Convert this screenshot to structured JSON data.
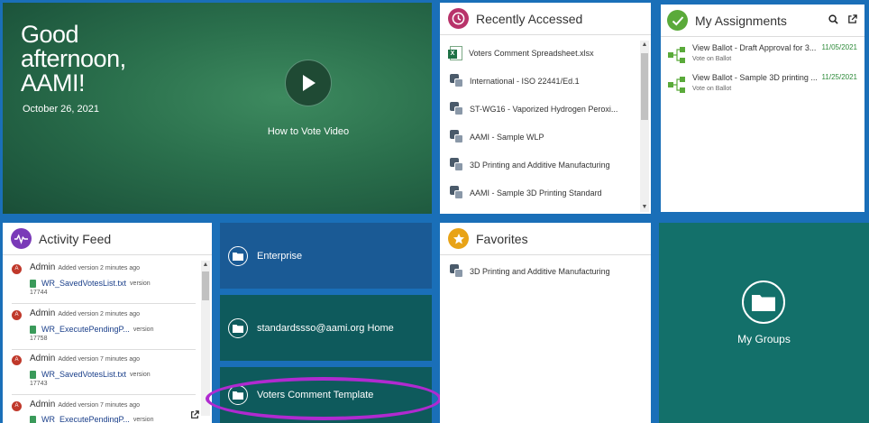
{
  "hero": {
    "greeting_line1": "Good",
    "greeting_line2": "afternoon,",
    "greeting_line3": "AAMI!",
    "date": "October 26, 2021",
    "video_label": "How to Vote Video",
    "play_icon": "play-icon"
  },
  "recent": {
    "title": "Recently Accessed",
    "icon": "clock-icon",
    "accent": "#b8336a",
    "items": [
      {
        "label": "Voters Comment Spreadsheet.xlsx",
        "icon": "excel-icon"
      },
      {
        "label": "International - ISO 22441/Ed.1",
        "icon": "document-icon"
      },
      {
        "label": "ST-WG16 - Vaporized Hydrogen Peroxi...",
        "icon": "document-icon"
      },
      {
        "label": "AAMI - Sample WLP",
        "icon": "document-icon"
      },
      {
        "label": "3D Printing and Additive Manufacturing",
        "icon": "document-icon"
      },
      {
        "label": "AAMI - Sample 3D Printing Standard",
        "icon": "document-icon"
      }
    ]
  },
  "assignments": {
    "title": "My Assignments",
    "accent": "#5aaa3a",
    "items": [
      {
        "title": "View Ballot - Draft Approval for 3...",
        "subtitle": "Vote on Ballot",
        "date": "11/05/2021"
      },
      {
        "title": "View Ballot - Sample 3D printing ...",
        "subtitle": "Vote on Ballot",
        "date": "11/25/2021"
      }
    ]
  },
  "activity": {
    "title": "Activity Feed",
    "accent": "#7a3ab8",
    "items": [
      {
        "avatar": "A",
        "user": "Admin",
        "action": "Added version 2 minutes ago",
        "file": "WR_SavedVotesList.txt",
        "suffix": "version",
        "number": "17744"
      },
      {
        "avatar": "A",
        "user": "Admin",
        "action": "Added version 2 minutes ago",
        "file": "WR_ExecutePendingP...",
        "suffix": "version",
        "number": "17758"
      },
      {
        "avatar": "A",
        "user": "Admin",
        "action": "Added version 7 minutes ago",
        "file": "WR_SavedVotesList.txt",
        "suffix": "version",
        "number": "17743"
      },
      {
        "avatar": "A",
        "user": "Admin",
        "action": "Added version 7 minutes ago",
        "file": "WR_ExecutePendingP...",
        "suffix": "version",
        "number": ""
      }
    ]
  },
  "folders": [
    {
      "label": "Enterprise",
      "color": "#1a5a95"
    },
    {
      "label": "standardssso@aami.org Home",
      "color": "#0e5a5c"
    },
    {
      "label": "Voters Comment Template",
      "color": "#0e5a5c"
    }
  ],
  "favorites": {
    "title": "Favorites",
    "accent": "#e8a317",
    "items": [
      {
        "label": "3D Printing and Additive Manufacturing",
        "icon": "document-icon"
      }
    ]
  },
  "groups": {
    "label": "My Groups",
    "color": "#13706a"
  }
}
